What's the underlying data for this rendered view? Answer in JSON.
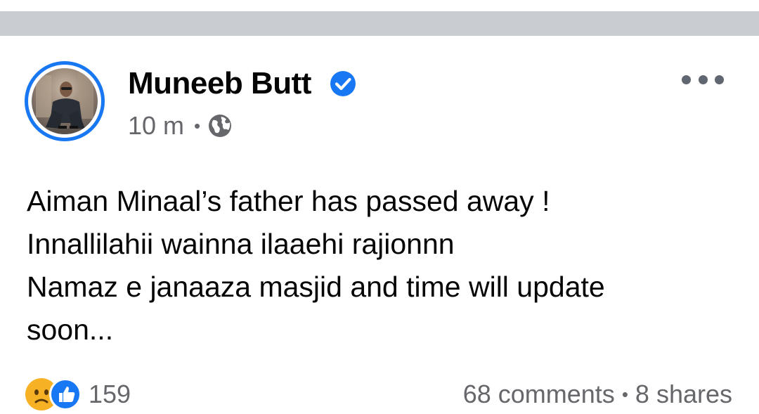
{
  "post": {
    "author": {
      "name": "Muneeb Butt",
      "verified": true,
      "avatar_icon": "profile-photo"
    },
    "timestamp": "10 m",
    "separator": "•",
    "audience_icon": "globe-icon",
    "more_icon": "more-horizontal-icon",
    "text_lines": [
      "Aiman Minaal’s father has passed away !",
      "Innallilahii wainna ilaaehi rajionnn",
      "Namaz e janaaza masjid and time will update",
      "soon..."
    ],
    "reactions": {
      "icons": [
        "sad-reaction-icon",
        "like-reaction-icon"
      ],
      "count": "159"
    },
    "comments": "68 comments",
    "stats_separator": "•",
    "shares": "8 shares"
  },
  "colors": {
    "brand": "#1877f2",
    "secondary_text": "#65676b",
    "divider": "#c9ccd1"
  }
}
